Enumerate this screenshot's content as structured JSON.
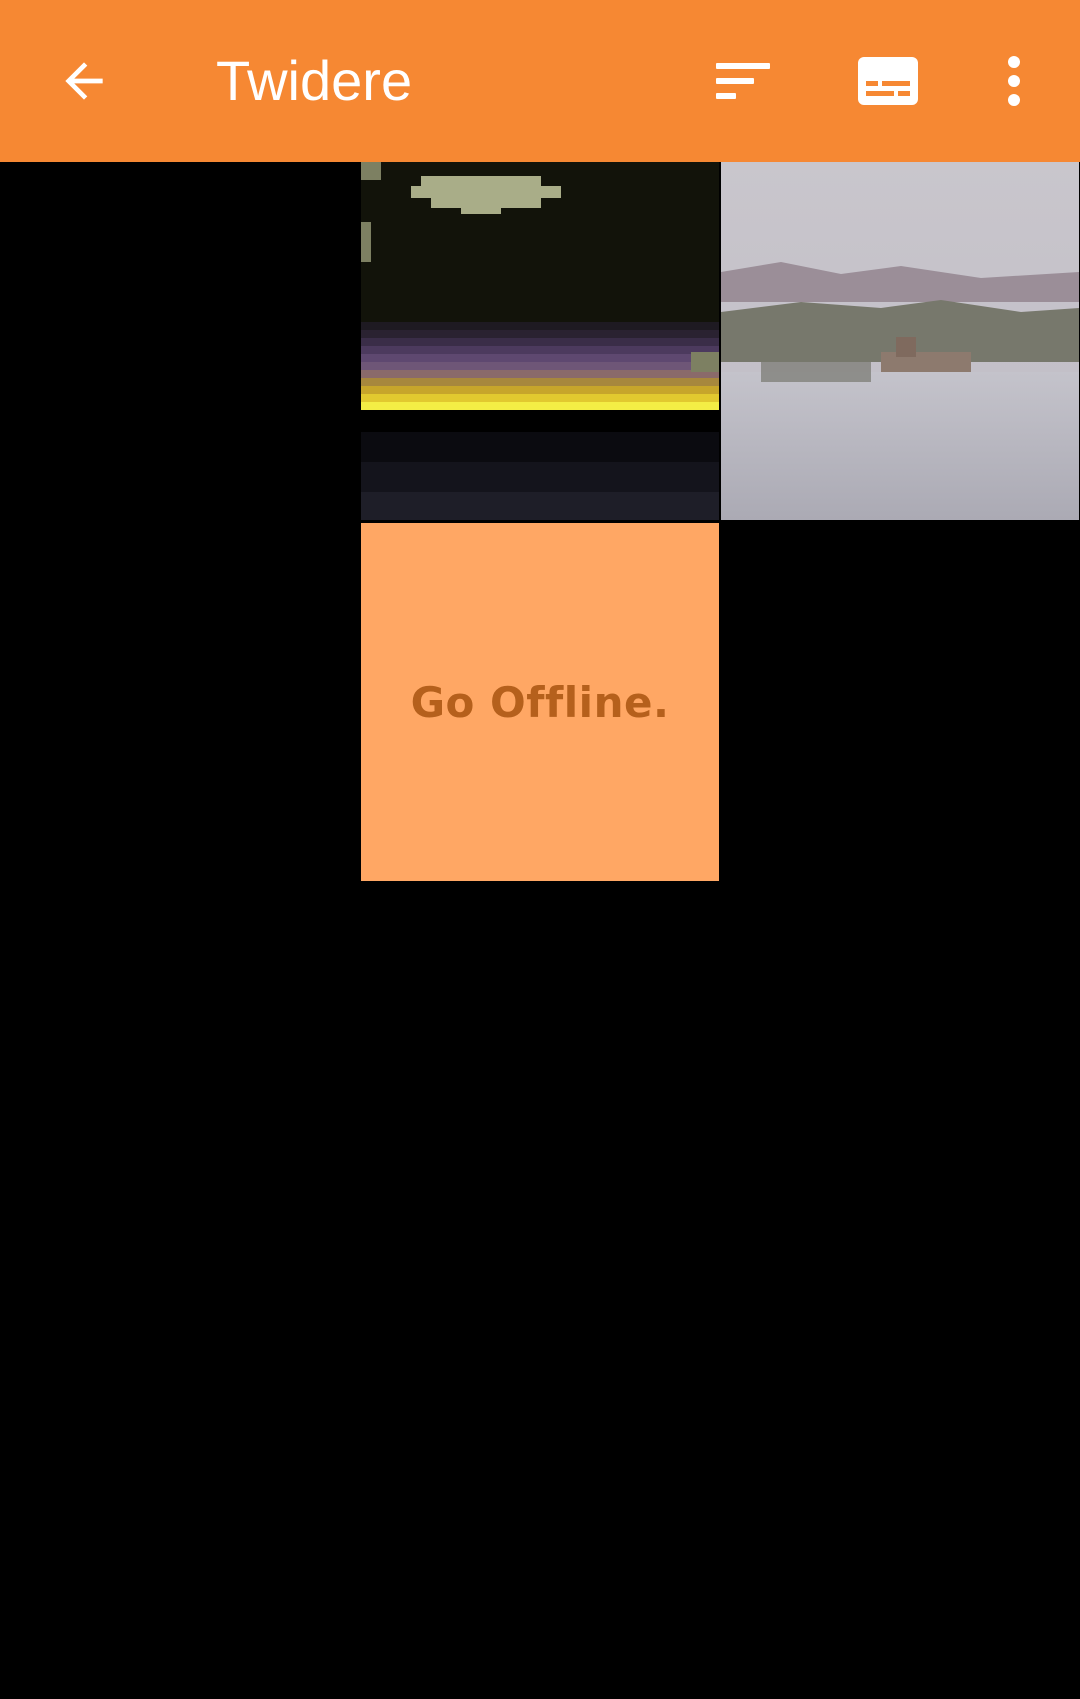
{
  "app_bar": {
    "title": "Twidere",
    "background_color": "#F68833",
    "icons": {
      "back": "arrow-left-icon",
      "sort": "sort-icon",
      "subtitles": "subtitles-icon",
      "more": "more-vert-icon"
    }
  },
  "media_grid": {
    "tiles": [
      {
        "kind": "image",
        "description_icon": "pixel-sunset-clouds-image"
      },
      {
        "kind": "image",
        "description_icon": "foggy-village-landscape-image"
      },
      {
        "kind": "image",
        "text": "Go Offline.",
        "background_color": "#FFA764",
        "text_color": "#B5601C"
      }
    ]
  }
}
